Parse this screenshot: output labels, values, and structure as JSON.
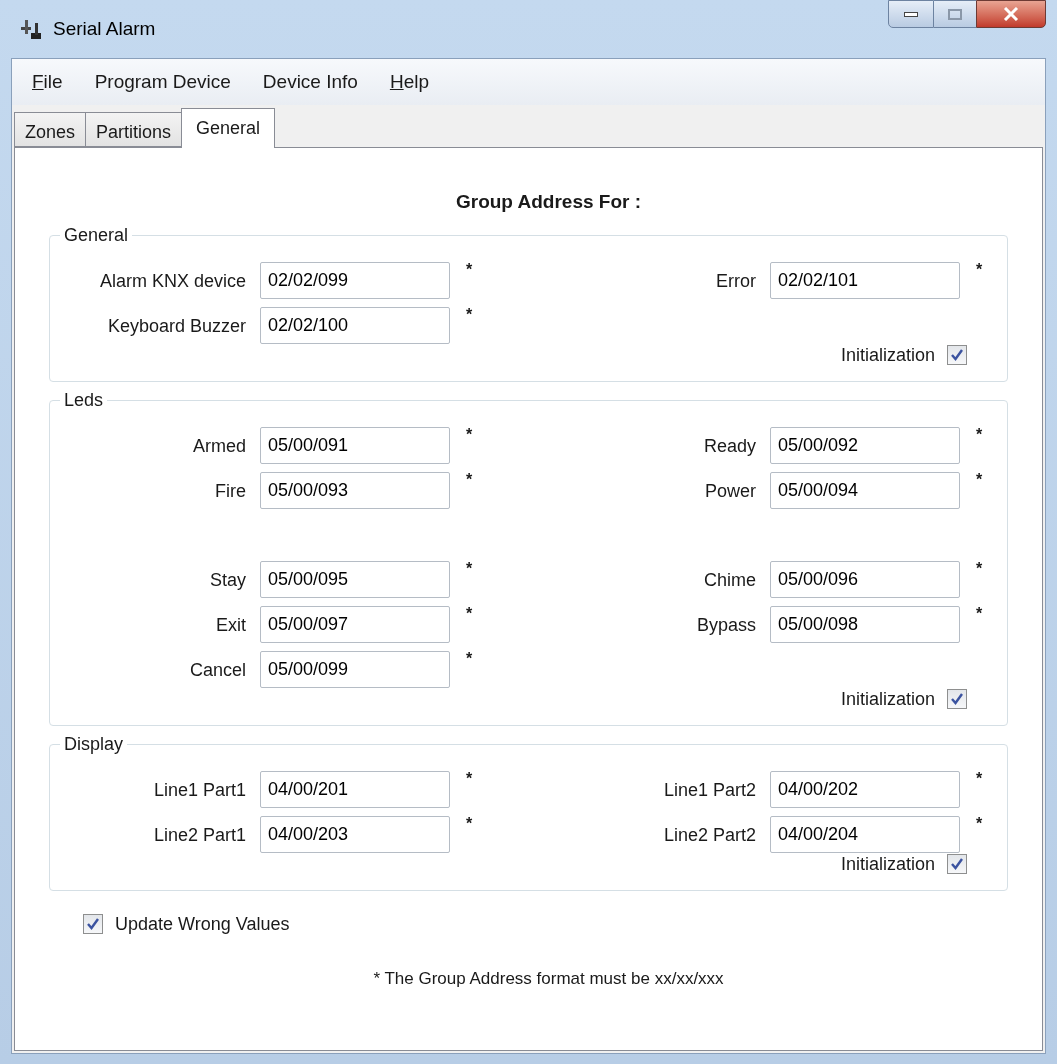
{
  "window": {
    "title": "Serial Alarm"
  },
  "menu": [
    {
      "accelerator": "F",
      "rest": "ile"
    },
    {
      "label": "Program Device"
    },
    {
      "label": "Device Info"
    },
    {
      "accelerator": "H",
      "rest": "elp"
    }
  ],
  "tabs": [
    {
      "label": "Zones",
      "selected": false
    },
    {
      "label": "Partitions",
      "selected": false
    },
    {
      "label": "General",
      "selected": true
    }
  ],
  "heading": "Group Address For :",
  "groups": [
    {
      "title": "General",
      "rows": [
        {
          "kind": "fields",
          "left": {
            "label": "Alarm KNX device",
            "value": "02/02/099",
            "marker": "*"
          },
          "right": {
            "label": "Error",
            "value": "02/02/101",
            "marker": "*"
          }
        },
        {
          "kind": "fields",
          "left": {
            "label": "Keyboard Buzzer",
            "value": "02/02/100",
            "marker": "*"
          }
        }
      ],
      "initialization": {
        "label": "Initialization",
        "checked": true
      }
    },
    {
      "title": "Leds",
      "rows": [
        {
          "kind": "fields",
          "left": {
            "label": "Armed",
            "value": "05/00/091",
            "marker": "*"
          },
          "right": {
            "label": "Ready",
            "value": "05/00/092",
            "marker": "*"
          }
        },
        {
          "kind": "fields",
          "left": {
            "label": "Fire",
            "value": "05/00/093",
            "marker": "*"
          },
          "right": {
            "label": "Power",
            "value": "05/00/094",
            "marker": "*"
          }
        },
        {
          "kind": "gap"
        },
        {
          "kind": "fields",
          "left": {
            "label": "Stay",
            "value": "05/00/095",
            "marker": "*"
          },
          "right": {
            "label": "Chime",
            "value": "05/00/096",
            "marker": "*"
          }
        },
        {
          "kind": "fields",
          "left": {
            "label": "Exit",
            "value": "05/00/097",
            "marker": "*"
          },
          "right": {
            "label": "Bypass",
            "value": "05/00/098",
            "marker": "*"
          }
        },
        {
          "kind": "fields",
          "left": {
            "label": "Cancel",
            "value": "05/00/099",
            "marker": "*"
          }
        }
      ],
      "initialization": {
        "label": "Initialization",
        "checked": true
      }
    },
    {
      "title": "Display",
      "rows": [
        {
          "kind": "fields",
          "left": {
            "label": "Line1 Part1",
            "value": "04/00/201",
            "marker": "*"
          },
          "right": {
            "label": "Line1 Part2",
            "value": "04/00/202",
            "marker": "*"
          }
        },
        {
          "kind": "fields",
          "left": {
            "label": "Line2 Part1",
            "value": "04/00/203",
            "marker": "*"
          },
          "right": {
            "label": "Line2 Part2",
            "value": "04/00/204",
            "marker": "*"
          }
        }
      ],
      "initialization": {
        "label": "Initialization",
        "checked": true
      }
    }
  ],
  "update_wrong_values": {
    "label": "Update Wrong Values",
    "checked": true
  },
  "footnote": "* The Group Address format must be xx/xx/xxx"
}
